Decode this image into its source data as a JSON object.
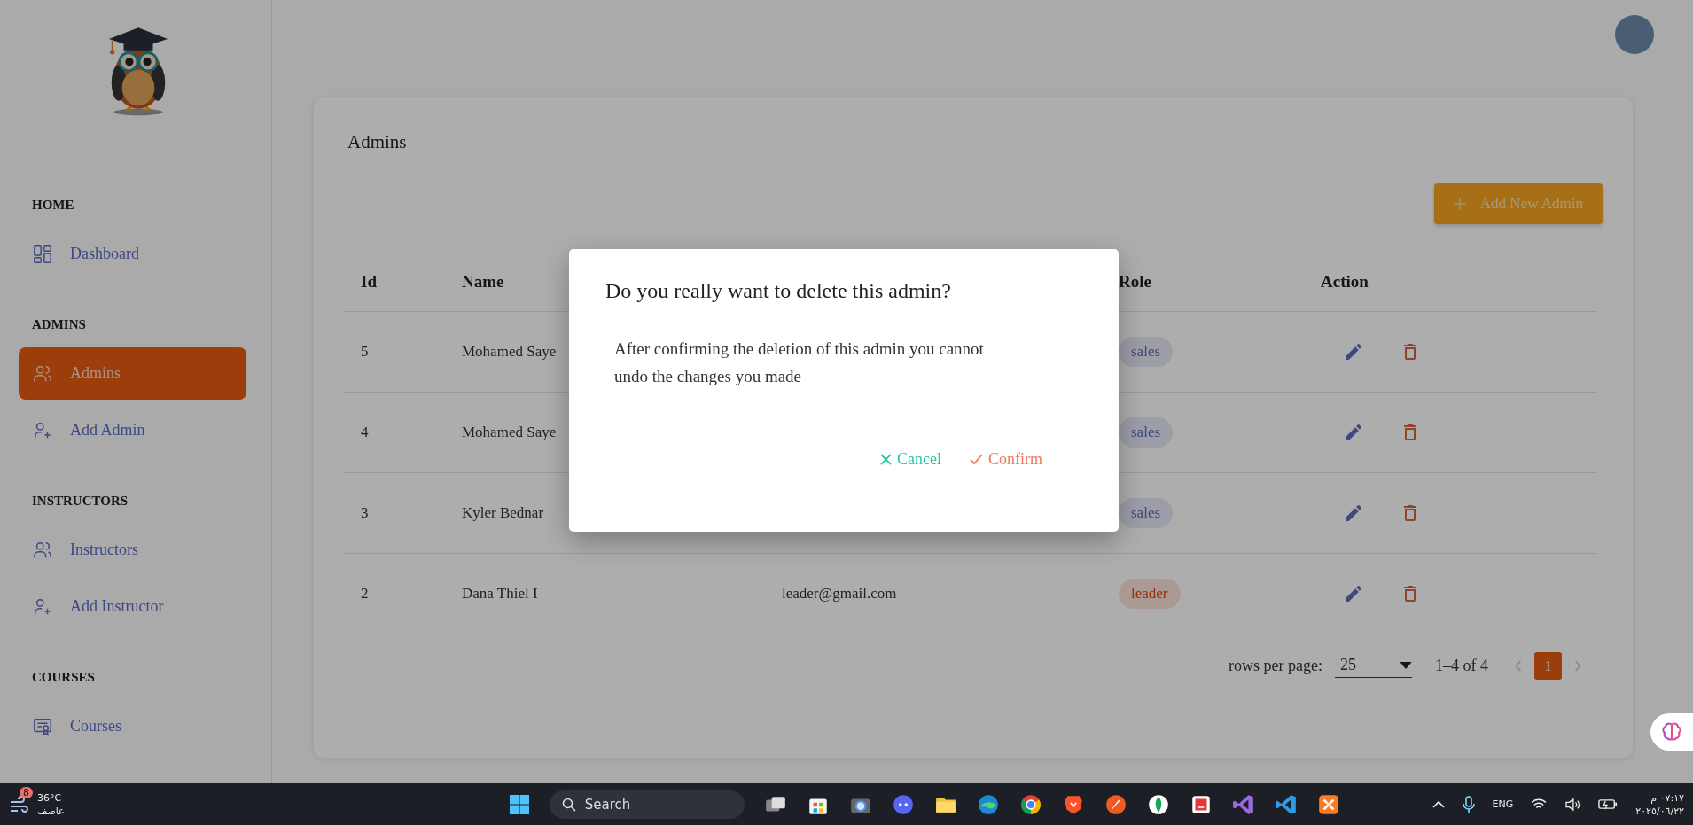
{
  "sidebar": {
    "sections": [
      {
        "heading": "HOME",
        "items": [
          {
            "label": "Dashboard",
            "kind": "dashboard",
            "selected": false
          }
        ]
      },
      {
        "heading": "ADMINS",
        "items": [
          {
            "label": "Admins",
            "kind": "users",
            "selected": true
          },
          {
            "label": "Add Admin",
            "kind": "useradd",
            "selected": false
          }
        ]
      },
      {
        "heading": "INSTRUCTORS",
        "items": [
          {
            "label": "Instructors",
            "kind": "users",
            "selected": false
          },
          {
            "label": "Add Instructor",
            "kind": "useradd",
            "selected": false
          }
        ]
      },
      {
        "heading": "COURSES",
        "items": [
          {
            "label": "Courses",
            "kind": "certificate",
            "selected": false
          }
        ]
      }
    ]
  },
  "page": {
    "title": "Admins",
    "add_button": "Add New Admin",
    "table": {
      "columns": [
        "Id",
        "Name",
        "",
        "Role",
        "Action"
      ],
      "rows": [
        {
          "id": "5",
          "name": "Mohamed Saye",
          "email": "",
          "role": "sales",
          "kind": "sales"
        },
        {
          "id": "4",
          "name": "Mohamed Saye",
          "email": "",
          "role": "sales",
          "kind": "sales"
        },
        {
          "id": "3",
          "name": "Kyler Bednar",
          "email": "",
          "role": "sales",
          "kind": "sales"
        },
        {
          "id": "2",
          "name": "Dana Thiel I",
          "email": "leader@gmail.com",
          "role": "leader",
          "kind": "leader"
        }
      ]
    },
    "pagination": {
      "rows_label": "rows per page:",
      "rows_value": "25",
      "range": "1–4 of 4",
      "pages": [
        {
          "label": "1",
          "selected": true
        }
      ]
    }
  },
  "dialog": {
    "title": "Do you really want to delete this admin?",
    "message": "After confirming the deletion of this admin you cannot undo the changes you made",
    "cancel": "Cancel",
    "confirm": "Confirm"
  },
  "taskbar": {
    "weather_badge": "8",
    "temperature": "36°C",
    "condition": "عاصف",
    "search": "Search",
    "language": "ENG",
    "time": "٠٧:١٧ م",
    "date": "٢٠٢٥/٠٦/٢٢"
  }
}
